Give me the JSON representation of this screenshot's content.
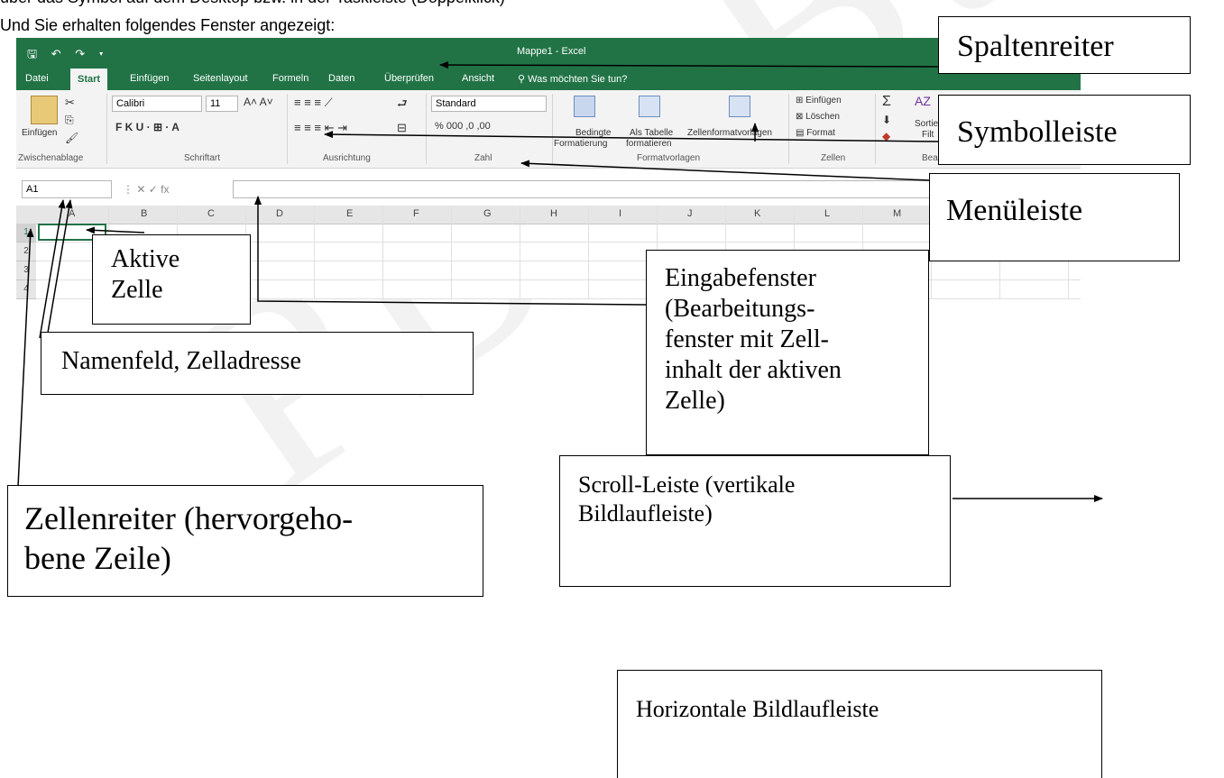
{
  "intro": {
    "cut_line": "über das Symbol auf dem Desktop bzw. in der Taskleiste (Doppelklick)",
    "line": "Und Sie erhalten folgendes Fenster angezeigt:"
  },
  "watermark": "PBS Bux",
  "excel": {
    "window_title": "Mappe1 - Excel",
    "quick_access": "🖫 ↶ ↷ ▾",
    "tabs": [
      "Datei",
      "Start",
      "Einfügen",
      "Seitenlayout",
      "Formeln",
      "Daten",
      "Überprüfen",
      "Ansicht",
      "Was möchten Sie tun?"
    ],
    "active_tab": "Start",
    "ribbon": {
      "paste_label": "Einfügen",
      "font_name": "Calibri",
      "font_size": "11",
      "font_buttons": "F  K  U  ·  ⊞  ·  A",
      "number_format": "Standard",
      "number_buttons": "% 000  ,0 ,00",
      "cond_format_1": "Bedingte",
      "cond_format_2": "Formatierung",
      "as_table_1": "Als Tabelle",
      "as_table_2": "formatieren",
      "cell_styles": "Zellenformatvorlagen",
      "insert": "Einfügen",
      "delete": "Löschen",
      "format": "Format",
      "sort_1": "Sortie",
      "sort_2": "Filt",
      "groups": [
        "Zwischenablage",
        "Schriftart",
        "Ausrichtung",
        "Zahl",
        "Formatvorlagen",
        "Zellen",
        "Bearbeiten"
      ]
    },
    "name_box": "A1",
    "formula_icons": "⋮  ✕  ✓  fx",
    "columns": [
      "A",
      "B",
      "C",
      "D",
      "E",
      "F",
      "G",
      "H",
      "I",
      "J",
      "K",
      "L",
      "M"
    ],
    "rows": [
      "1",
      "2",
      "3",
      "4"
    ]
  },
  "labels": {
    "spaltenreiter": "Spaltenreiter",
    "symbolleiste": "Symbolleiste",
    "menueleiste": "Menüleiste",
    "aktive_zelle_1": "Aktive",
    "aktive_zelle_2": "Zelle",
    "namenfeld": "Namenfeld, Zelladresse",
    "eingabe_1": "Eingabefenster",
    "eingabe_2": "(Bearbeitungs-",
    "eingabe_3": "fenster mit Zell-",
    "eingabe_4": "inhalt der aktiven",
    "eingabe_5": "Zelle)",
    "scroll_1": "Scroll-Leiste (vertikale",
    "scroll_2": "Bildlaufleiste)",
    "zellenreiter_1": "Zellenreiter (hervorgeho-",
    "zellenreiter_2": "bene Zeile)",
    "horizontal": "Horizontale Bildlaufleiste"
  },
  "colors": {
    "excel_green": "#217346",
    "ribbon_bg": "#f3f3f3"
  }
}
